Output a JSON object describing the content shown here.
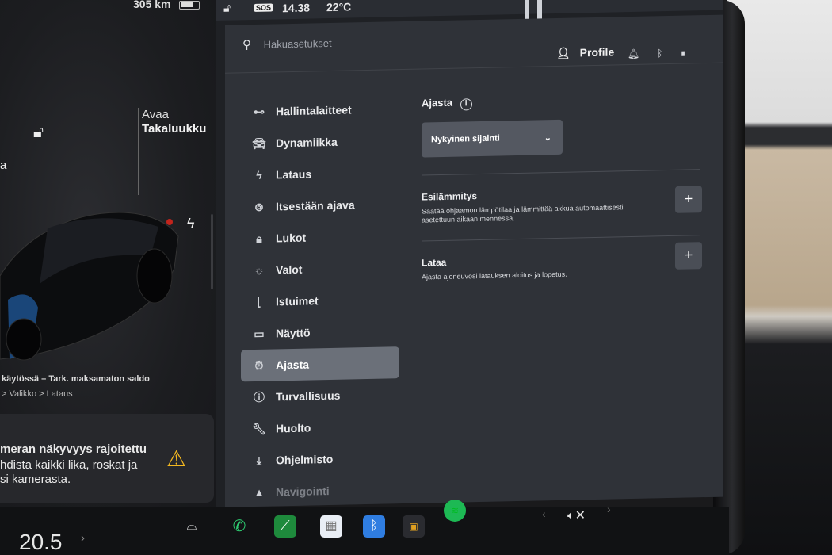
{
  "status": {
    "range": "305 km",
    "sos": "SOS",
    "time": "14.38",
    "temperature": "22°C"
  },
  "car_panel": {
    "trunk_open": "Avaa",
    "trunk_name": "Takaluukku",
    "warning_line": "käytössä – Tark. maksamaton saldo",
    "warning_path": "> Valikko > Lataus",
    "camera_title": "meran näkyvyys rajoitettu",
    "camera_line2": "hdista kaikki lika, roskat ja",
    "camera_line3": "si kamerasta.",
    "left_line": "a"
  },
  "settings": {
    "search_placeholder": "Hakuasetukset",
    "profile_label": "Profile",
    "menu": [
      {
        "label": "Hallintalaitteet",
        "icon": "toggle-icon"
      },
      {
        "label": "Dynamiikka",
        "icon": "car-icon"
      },
      {
        "label": "Lataus",
        "icon": "bolt-icon"
      },
      {
        "label": "Itsestään ajava",
        "icon": "steering-wheel-icon"
      },
      {
        "label": "Lukot",
        "icon": "lock-icon"
      },
      {
        "label": "Valot",
        "icon": "sun-icon"
      },
      {
        "label": "Istuimet",
        "icon": "seat-icon"
      },
      {
        "label": "Näyttö",
        "icon": "display-icon"
      },
      {
        "label": "Ajasta",
        "icon": "alarm-clock-icon"
      },
      {
        "label": "Turvallisuus",
        "icon": "alert-circle-icon"
      },
      {
        "label": "Huolto",
        "icon": "wrench-icon"
      },
      {
        "label": "Ohjelmisto",
        "icon": "download-icon"
      },
      {
        "label": "Navigointi",
        "icon": "navigation-icon"
      }
    ],
    "active_item": "Ajasta",
    "content": {
      "title": "Ajasta",
      "location_value": "Nykyinen sijainti",
      "preheat_title": "Esilämmitys",
      "preheat_desc": "Säätää ohjaamon lämpötilaa ja lämmittää akkua automaattisesti asetettuun aikaan mennessä.",
      "charge_title": "Lataa",
      "charge_desc": "Ajasta ajoneuvosi latauksen aloitus ja lopetus."
    }
  },
  "taskbar": {
    "speed_value": "20.5"
  },
  "colors": {
    "active_bg": "#6b7079",
    "panel_bg": "#2f3238",
    "warning": "#f3b820",
    "phone": "#2ecc71",
    "spotify": "#1db954"
  }
}
